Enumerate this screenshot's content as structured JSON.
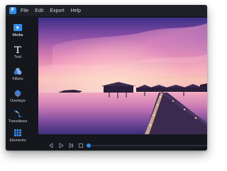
{
  "app": {
    "logo_glyph": "F",
    "accent_color": "#2d8cf0"
  },
  "menu": {
    "items": [
      "File",
      "Edit",
      "Export",
      "Help"
    ]
  },
  "sidebar": {
    "items": [
      {
        "label": "Media",
        "icon": "media-icon",
        "active": true
      },
      {
        "label": "Text",
        "icon": "text-icon",
        "active": false
      },
      {
        "label": "Filters",
        "icon": "filters-icon",
        "active": false
      },
      {
        "label": "Overlays",
        "icon": "overlays-icon",
        "active": false
      },
      {
        "label": "Transitions",
        "icon": "transitions-icon",
        "active": false
      },
      {
        "label": "Elements",
        "icon": "elements-icon",
        "active": false
      }
    ]
  },
  "preview": {
    "content": "sunset-over-sea-with-overwater-bungalows-and-pier"
  },
  "playback": {
    "buttons": [
      "previous-icon",
      "play-icon",
      "next-icon",
      "stop-icon"
    ],
    "progress": 0.0
  }
}
